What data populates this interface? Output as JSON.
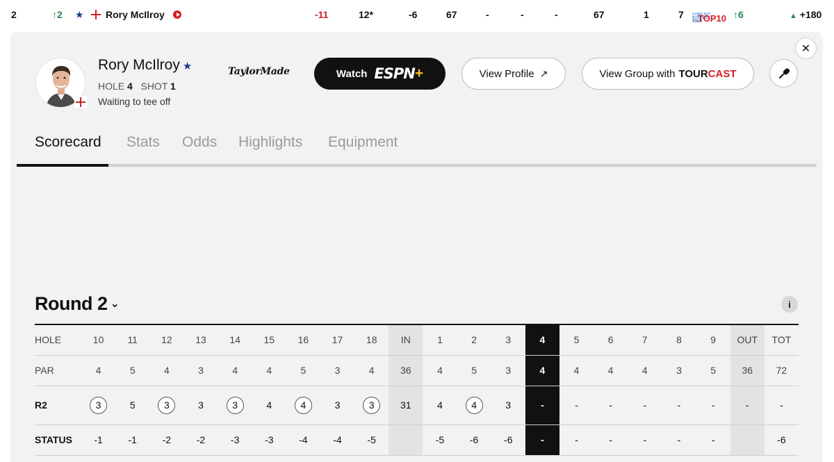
{
  "leaderboard_row": {
    "position": "2",
    "movement": "2",
    "player_name": "Rory McIlroy",
    "to_par": "-11",
    "thru": "12*",
    "today": "-6",
    "r1": "67",
    "r2": "-",
    "r3": "-",
    "r4": "-",
    "total": "67",
    "proj_pos": "1",
    "top10_rank": "7",
    "top10_logo": {
      "line1": "COMCAST",
      "line2": "BUSINESS",
      "line3": "TOUR",
      "line4": "TOP10"
    },
    "top10_movement": "6",
    "odds": "+180",
    "odds_direction": "up"
  },
  "player_card": {
    "name": "Rory McIlroy",
    "hole_label": "HOLE",
    "hole": "4",
    "shot_label": "SHOT",
    "shot": "1",
    "status": "Waiting to tee off",
    "sponsor": "TaylorMade",
    "watch_button": {
      "label": "Watch",
      "brand": "ESPN",
      "brand_plus": "+"
    },
    "profile_button": "View Profile",
    "group_button": {
      "label": "View Group with",
      "brand_a": "TOUR",
      "brand_b": "CAST"
    },
    "close_label": "✕"
  },
  "tabs": [
    "Scorecard",
    "Stats",
    "Odds",
    "Highlights",
    "Equipment"
  ],
  "active_tab": "Scorecard",
  "round_selector": {
    "label": "Round 2",
    "chevron": "⌄"
  },
  "info_label": "i",
  "scorecard": {
    "columns": [
      "HOLE",
      "10",
      "11",
      "12",
      "13",
      "14",
      "15",
      "16",
      "17",
      "18",
      "IN",
      "1",
      "2",
      "3",
      "4",
      "5",
      "6",
      "7",
      "8",
      "9",
      "OUT",
      "TOT"
    ],
    "par": [
      "PAR",
      "4",
      "5",
      "4",
      "3",
      "4",
      "4",
      "5",
      "3",
      "4",
      "36",
      "4",
      "5",
      "3",
      "4",
      "4",
      "4",
      "4",
      "3",
      "5",
      "36",
      "72"
    ],
    "round": [
      "R2",
      "3",
      "5",
      "3",
      "3",
      "3",
      "4",
      "4",
      "3",
      "3",
      "31",
      "4",
      "4",
      "3",
      "-",
      "-",
      "-",
      "-",
      "-",
      "-",
      "-",
      "-"
    ],
    "round_birdie_cols": [
      1,
      3,
      5,
      7,
      9,
      12
    ],
    "status": [
      "STATUS",
      "-1",
      "-1",
      "-2",
      "-2",
      "-3",
      "-3",
      "-4",
      "-4",
      "-5",
      "",
      "-5",
      "-6",
      "-6",
      "-",
      "-",
      "-",
      "-",
      "-",
      "-",
      "",
      "-6"
    ],
    "current_hole_col": 14,
    "subtotal_cols": [
      10,
      20
    ]
  },
  "colors": {
    "accent_red": "#d31f26",
    "up_green": "#1f8a4c",
    "panel_bg": "#f2f2f2",
    "current_hole": "#111111"
  }
}
